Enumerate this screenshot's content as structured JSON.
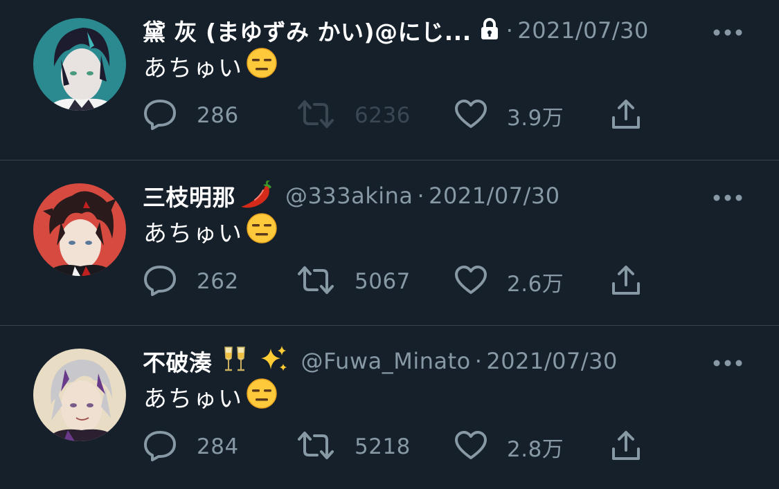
{
  "tweets": [
    {
      "display_name": "黛 灰 (まゆずみ かい)@にじ...",
      "name_emoji": "",
      "handle": "",
      "protected": true,
      "separator": "·",
      "date": "2021/07/30",
      "text": "あちゅい",
      "text_emoji": "expressionless-face",
      "replies": "286",
      "retweets": "6236",
      "retweets_disabled": true,
      "likes": "3.9万",
      "avatar_colors": {
        "bg": "#2a8a90",
        "hair": "#1c1c2e",
        "skin": "#e8e2e0"
      }
    },
    {
      "display_name": "三枝明那",
      "name_emoji": "chili-pepper",
      "handle": "@333akina",
      "protected": false,
      "separator": "·",
      "date": "2021/07/30",
      "text": "あちゅい",
      "text_emoji": "expressionless-face",
      "replies": "262",
      "retweets": "5067",
      "retweets_disabled": false,
      "likes": "2.6万",
      "avatar_colors": {
        "bg": "#d64a40",
        "hair": "#2a1a1c",
        "skin": "#f2e2d6"
      }
    },
    {
      "display_name": "不破湊",
      "name_emoji": "champagne-glasses sparkles",
      "handle": "@Fuwa_Minato",
      "protected": false,
      "separator": "·",
      "date": "2021/07/30",
      "text": "あちゅい",
      "text_emoji": "expressionless-face",
      "replies": "284",
      "retweets": "5218",
      "retweets_disabled": false,
      "likes": "2.8万",
      "avatar_colors": {
        "bg": "#e8dcc4",
        "hair": "#c8c8cc",
        "skin": "#f0e0d2"
      }
    }
  ],
  "colors": {
    "background": "#15202b",
    "divider": "#38444d",
    "secondary_text": "#8899a6",
    "primary_text": "#ffffff"
  }
}
